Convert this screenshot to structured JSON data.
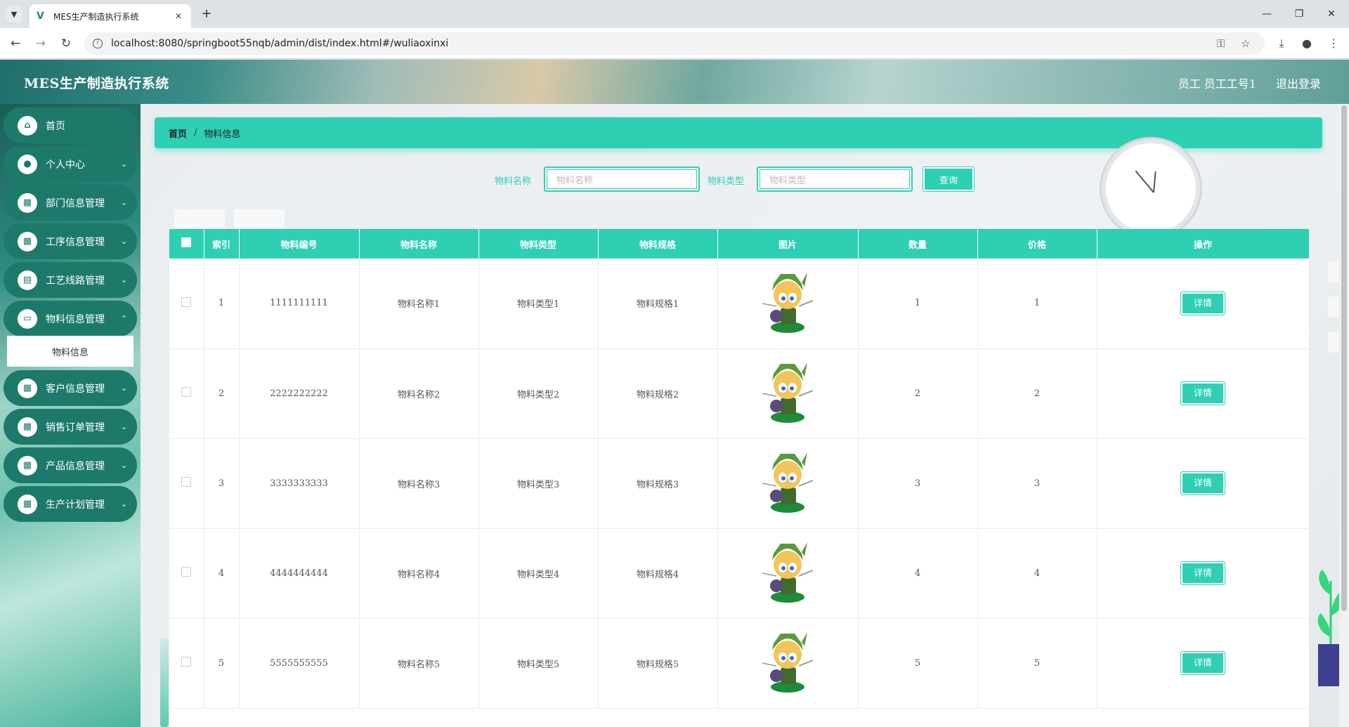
{
  "browser": {
    "tab_title": "MES生产制造执行系统",
    "url": "localhost:8080/springboot55nqb/admin/dist/index.html#/wuliaoxinxi"
  },
  "header": {
    "app_title": "MES生产制造执行系统",
    "user_info": "员工 员工工号1",
    "logout_label": "退出登录"
  },
  "sidebar": {
    "items": [
      {
        "label": "首页",
        "icon": "home-icon"
      },
      {
        "label": "个人中心",
        "icon": "user-icon"
      },
      {
        "label": "部门信息管理",
        "icon": "grid-icon"
      },
      {
        "label": "工序信息管理",
        "icon": "grid-icon"
      },
      {
        "label": "工艺线路管理",
        "icon": "clipboard-icon"
      },
      {
        "label": "物料信息管理",
        "icon": "monitor-icon"
      },
      {
        "label": "客户信息管理",
        "icon": "grid-icon"
      },
      {
        "label": "销售订单管理",
        "icon": "grid-icon"
      },
      {
        "label": "产品信息管理",
        "icon": "grid-icon"
      },
      {
        "label": "生产计划管理",
        "icon": "grid-icon"
      }
    ],
    "active_submenu": "物料信息"
  },
  "breadcrumb": {
    "home": "首页",
    "separator": "/",
    "current": "物料信息"
  },
  "search": {
    "name_label": "物料名称",
    "name_placeholder": "物料名称",
    "type_label": "物料类型",
    "type_placeholder": "物料类型",
    "query_button": "查询"
  },
  "table": {
    "columns": [
      "",
      "索引",
      "物料编号",
      "物料名称",
      "物料类型",
      "物料规格",
      "图片",
      "数量",
      "价格",
      "操作"
    ],
    "rows": [
      {
        "index": "1",
        "code": "1111111111",
        "name": "物料名称1",
        "type": "物料类型1",
        "spec": "物料规格1",
        "qty": "1",
        "price": "1",
        "action": "详情"
      },
      {
        "index": "2",
        "code": "2222222222",
        "name": "物料名称2",
        "type": "物料类型2",
        "spec": "物料规格2",
        "qty": "2",
        "price": "2",
        "action": "详情"
      },
      {
        "index": "3",
        "code": "3333333333",
        "name": "物料名称3",
        "type": "物料类型3",
        "spec": "物料规格3",
        "qty": "3",
        "price": "3",
        "action": "详情"
      },
      {
        "index": "4",
        "code": "4444444444",
        "name": "物料名称4",
        "type": "物料类型4",
        "spec": "物料规格4",
        "qty": "4",
        "price": "4",
        "action": "详情"
      },
      {
        "index": "5",
        "code": "5555555555",
        "name": "物料名称5",
        "type": "物料类型5",
        "spec": "物料规格5",
        "qty": "5",
        "price": "5",
        "action": "详情"
      }
    ]
  },
  "colors": {
    "accent": "#2ecfb3",
    "sidebar_item": "#1d7a6b"
  }
}
